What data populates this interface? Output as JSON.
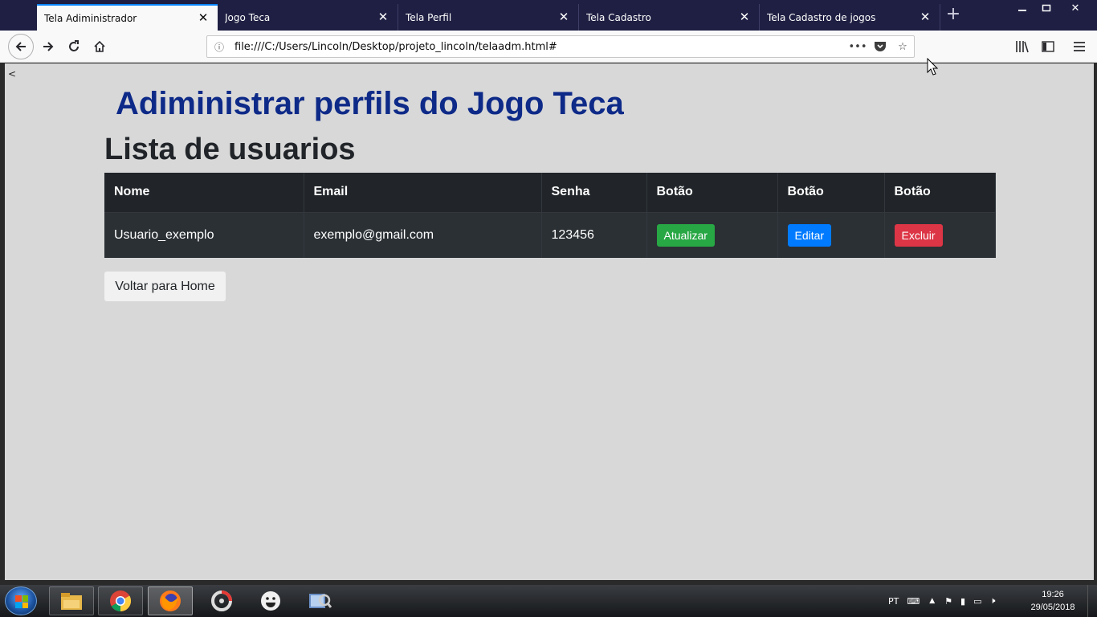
{
  "browser": {
    "tabs": [
      {
        "label": "Tela Adiministrador",
        "active": true
      },
      {
        "label": "Jogo Teca",
        "active": false
      },
      {
        "label": "Tela Perfil",
        "active": false
      },
      {
        "label": "Tela Cadastro",
        "active": false
      },
      {
        "label": "Tela Cadastro de jogos",
        "active": false
      }
    ],
    "url": "file:///C:/Users/Lincoln/Desktop/projeto_lincoln/telaadm.html#",
    "accent_color": "#0a84ff",
    "titlebar_color": "#1f1f43"
  },
  "page": {
    "back_text": "<",
    "title": "Adiministrar perfils do Jogo Teca",
    "subtitle": "Lista de usuarios",
    "table": {
      "headers": [
        "Nome",
        "Email",
        "Senha",
        "Botão",
        "Botão",
        "Botão"
      ],
      "rows": [
        {
          "nome": "Usuario_exemplo",
          "email": "exemplo@gmail.com",
          "senha": "123456",
          "btn_atualizar": "Atualizar",
          "btn_editar": "Editar",
          "btn_excluir": "Excluir"
        }
      ]
    },
    "home_button": "Voltar para Home",
    "colors": {
      "title": "#0e2a88",
      "background": "#d8d8d8",
      "table_header": "#212529",
      "atualizar": "#28a745",
      "editar": "#007bff",
      "excluir": "#dc3545"
    }
  },
  "taskbar": {
    "language": "PT",
    "time": "19:26",
    "date": "29/05/2018",
    "apps": [
      "file-explorer-icon",
      "chrome-icon",
      "firefox-icon",
      "media-player-icon",
      "smiley-icon",
      "image-viewer-icon"
    ]
  }
}
